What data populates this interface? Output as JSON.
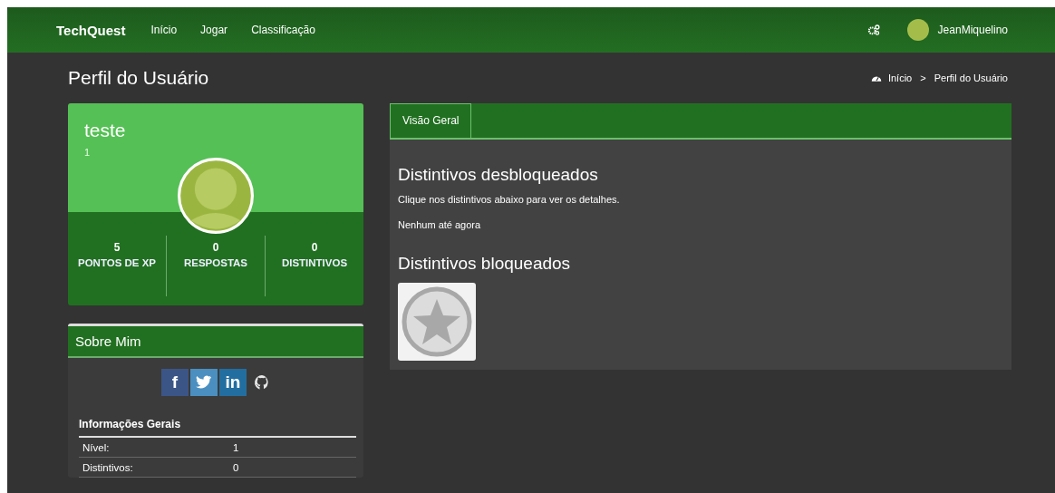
{
  "nav": {
    "brand": "TechQuest",
    "links": [
      "Início",
      "Jogar",
      "Classificação"
    ],
    "user": "JeanMiquelino"
  },
  "page_title": "Perfil do Usuário",
  "breadcrumb": {
    "items": [
      "Início",
      "Perfil do Usuário"
    ],
    "separator": ">"
  },
  "profile": {
    "name": "teste",
    "subtitle": "1",
    "stats": [
      {
        "value": "5",
        "label": "PONTOS DE XP"
      },
      {
        "value": "0",
        "label": "RESPOSTAS"
      },
      {
        "value": "0",
        "label": "DISTINTIVOS"
      }
    ]
  },
  "about": {
    "title": "Sobre Mim",
    "social": [
      {
        "kind": "facebook",
        "glyph": "f"
      },
      {
        "kind": "twitter"
      },
      {
        "kind": "linkedin",
        "glyph": "in"
      },
      {
        "kind": "github"
      }
    ]
  },
  "info": {
    "title": "Informações Gerais",
    "rows": [
      {
        "label": "Nível:",
        "value": "1"
      },
      {
        "label": "Distintivos:",
        "value": "0"
      }
    ]
  },
  "tabs": [
    {
      "label": "Visão Geral",
      "selected": true
    }
  ],
  "unlocked": {
    "title": "Distintivos desbloqueados",
    "hint": "Clique nos distintivos abaixo para ver os detalhes.",
    "empty": "Nenhum até agora"
  },
  "locked": {
    "title": "Distintivos bloqueados",
    "badges": [
      {
        "kind": "star"
      }
    ]
  }
}
